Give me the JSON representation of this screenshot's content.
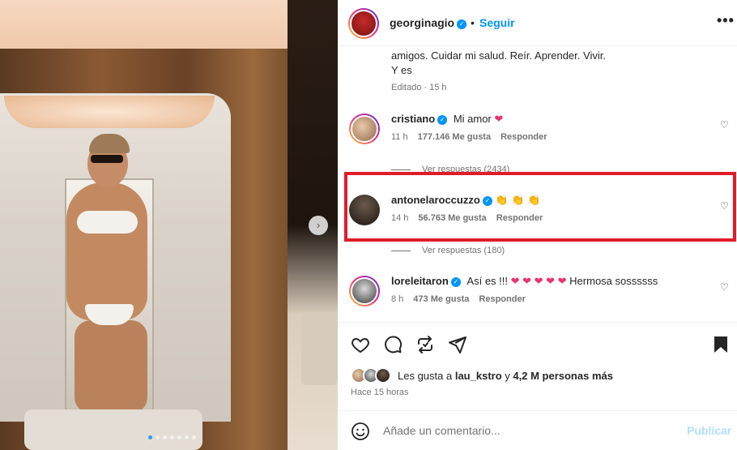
{
  "post": {
    "username": "georginagio",
    "dot": "•",
    "follow_label": "Seguir",
    "more_label": "•••",
    "caption_line1": "amigos. Cuidar mi salud. Reír. Aprender. Vivir.",
    "caption_line2": "Y es",
    "caption_meta": "Editado · 15 h"
  },
  "comments": [
    {
      "username": "cristiano",
      "text": "Mi amor",
      "emoji": "❤",
      "time": "11 h",
      "likes": "177.146 Me gusta",
      "reply_label": "Responder",
      "view_replies": "Ver respuestas (2434)"
    },
    {
      "username": "antonelaroccuzzo",
      "text": "",
      "emoji": "👏 👏 👏",
      "time": "14 h",
      "likes": "56.763 Me gusta",
      "reply_label": "Responder",
      "view_replies": "Ver respuestas (180)"
    },
    {
      "username": "loreleitaron",
      "text": "Así es !!!",
      "emoji": "❤ ❤ ❤ ❤ ❤",
      "text_after": "Hermosa sossssss",
      "time": "8 h",
      "likes": "473 Me gusta",
      "reply_label": "Responder"
    }
  ],
  "likes_summary": {
    "prefix": "Les gusta a",
    "user": "lau_kstro",
    "middle": "y",
    "others": "4,2 M personas más",
    "time_ago": "Hace 15 horas"
  },
  "add_comment": {
    "placeholder": "Añade un comentario...",
    "post_label": "Publicar"
  },
  "carousel": {
    "next_label": "›",
    "dot_count": 7,
    "active_index": 0
  },
  "colors": {
    "accent": "#0095f6",
    "highlight": "#e01c28",
    "heart": "#e8336e",
    "muted": "#737373"
  }
}
